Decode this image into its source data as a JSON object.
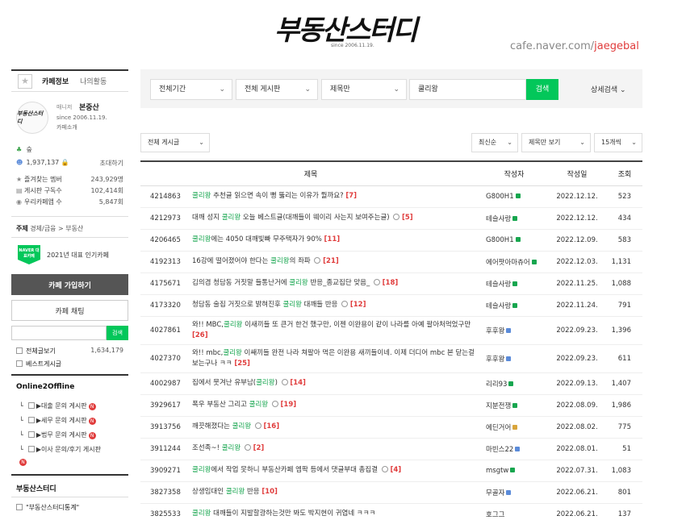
{
  "header": {
    "logo": "부동산스터디",
    "since": "since 2006.11.19.",
    "cafe_url_prefix": "cafe.naver.com/",
    "cafe_url_id": "jaegebal"
  },
  "sidebar": {
    "tabs": [
      "카페정보",
      "나의활동"
    ],
    "manager": {
      "avatar_text": "부동산스터디",
      "role": "매니저",
      "name": "본중산",
      "since": "since 2006.11.19.",
      "intro": "카페소개"
    },
    "stats": {
      "level": "숲",
      "members": "1,937,137",
      "invite": "초대하기",
      "fav_label": "즐겨찾는 멤버",
      "fav_value": "243,929명",
      "sub_label": "게시판 구독수",
      "sub_value": "102,414회",
      "app_label": "우리카페앱 수",
      "app_value": "5,847회"
    },
    "topic_label": "주제",
    "topic_value": "경제/금융 > 부동산",
    "badge_text": "NAVER 대표카페",
    "popular": "2021년 대표 인기카페",
    "join": "카페 가입하기",
    "chat": "카페 채팅",
    "search_btn": "검색",
    "all_posts_label": "전체글보기",
    "all_posts_count": "1,634,179",
    "best_posts": "베스트게시글",
    "section1": "Online2Offline",
    "boards": [
      "▶대출 문의 게시판",
      "▶세무 문의 게시판",
      "▶법무 문의 게시판",
      "▶이사 문의/후기 게시판"
    ],
    "new_badge": "N",
    "section2": "부동산스터디",
    "board_bottom": "\"부동산스터디통계\""
  },
  "search": {
    "period": "전체기간",
    "board": "전체 게시판",
    "scope": "제목만",
    "keyword": "쿨리왕",
    "button": "검색",
    "advanced": "상세검색"
  },
  "filters": {
    "board": "전체 게시글",
    "sort": "최신순",
    "view": "제목만 보기",
    "count": "15개씩"
  },
  "table": {
    "headers": [
      "제목",
      "작성자",
      "작성일",
      "조회"
    ],
    "rows": [
      {
        "num": "4214863",
        "pre": "",
        "hl": "쿨리왕",
        "post": " 추천글 읽으면 속이 뻥 뚫리는 이유가 뭘까요?",
        "cmt": "[7]",
        "emo": false,
        "author": "G800H1",
        "badge": "g",
        "date": "2022.12.12.",
        "views": "523"
      },
      {
        "num": "4212973",
        "pre": "대깨 성지 ",
        "hl": "쿨리왕",
        "post": " 오늘 베스트글(대깨들이 웨이리 사는지 보여주는글)",
        "cmt": "[5]",
        "emo": true,
        "author": "테슬사랑",
        "badge": "g",
        "date": "2022.12.12.",
        "views": "434"
      },
      {
        "num": "4206465",
        "pre": "",
        "hl": "쿨리왕",
        "post": "에는 4050 대깨빛빠 무주택자가 90%",
        "cmt": "[11]",
        "emo": false,
        "author": "G800H1",
        "badge": "g",
        "date": "2022.12.09.",
        "views": "583"
      },
      {
        "num": "4192313",
        "pre": "16강에 떨어졌어야 한다는 ",
        "hl": "쿨리왕",
        "post": "의 좌파",
        "cmt": "[21]",
        "emo": true,
        "author": "에어팟아마츄어",
        "badge": "g",
        "date": "2022.12.03.",
        "views": "1,131"
      },
      {
        "num": "4175671",
        "pre": "김의겸 청담동 거짓말 들통난거에 ",
        "hl": "쿨리왕",
        "post": " 반응_종교집단 맞음_",
        "cmt": "[18]",
        "emo": true,
        "author": "테슬사랑",
        "badge": "g",
        "date": "2022.11.25.",
        "views": "1,088"
      },
      {
        "num": "4173320",
        "pre": "청담동 술집 거짓으로 밝혀진후 ",
        "hl": "쿨리왕",
        "post": " 대깨들 반응",
        "cmt": "[12]",
        "emo": true,
        "author": "테슬사랑",
        "badge": "g",
        "date": "2022.11.24.",
        "views": "791"
      },
      {
        "num": "4027861",
        "pre": "와!! MBC,",
        "hl": "쿨리왕",
        "post": " 이새끼들 또 큰거 한건 했구만, 이젠 이완용이 같이 나라를 아예 팔아처먹었구만",
        "cmt": "[26]",
        "emo": false,
        "author": "후후왕",
        "badge": "b",
        "date": "2022.09.23.",
        "views": "1,396",
        "tall": true
      },
      {
        "num": "4027370",
        "pre": "와!! mbc,",
        "hl": "쿨리왕",
        "post": " 이쌔끼들 완전 나라 쳐팔아 먹은 이완용 새끼들이네. 이제 더디어 mbc 본 닫는걸 보는구나 ㅋㅋ",
        "cmt": "[25]",
        "emo": false,
        "author": "후후왕",
        "badge": "b",
        "date": "2022.09.23.",
        "views": "611",
        "tall": true
      },
      {
        "num": "4002987",
        "pre": "집에서 뭇겨난 유부남(",
        "hl": "쿨리왕",
        "post": ")",
        "cmt": "[14]",
        "emo": true,
        "author": "리리93",
        "badge": "g",
        "date": "2022.09.13.",
        "views": "1,407"
      },
      {
        "num": "3929617",
        "pre": "폭우 부동산 그리고 ",
        "hl": "쿨리왕",
        "post": "",
        "cmt": "[19]",
        "emo": true,
        "author": "지분전쟁",
        "badge": "g",
        "date": "2022.08.09.",
        "views": "1,986"
      },
      {
        "num": "3913756",
        "pre": "깨끗해졌다는 ",
        "hl": "쿨리왕",
        "post": "",
        "cmt": "[16]",
        "emo": true,
        "author": "에딘거어",
        "badge": "y",
        "date": "2022.08.02.",
        "views": "775"
      },
      {
        "num": "3911244",
        "pre": "조선족~! ",
        "hl": "쿨리왕",
        "post": "",
        "cmt": "[2]",
        "emo": true,
        "author": "마빈스22",
        "badge": "b",
        "date": "2022.08.01.",
        "views": "51"
      },
      {
        "num": "3909271",
        "pre": "",
        "hl": "쿨리왕",
        "post": "에서 작업 못하니 부동산카페 엠팍 등에서 댓글부대 총집결",
        "cmt": "[4]",
        "emo": true,
        "author": "msgtw",
        "badge": "g",
        "date": "2022.07.31.",
        "views": "1,083"
      },
      {
        "num": "3827358",
        "pre": "상생임대인 ",
        "hl": "쿨리왕",
        "post": " 반응",
        "cmt": "[10]",
        "emo": false,
        "author": "무골자",
        "badge": "b",
        "date": "2022.06.21.",
        "views": "801"
      },
      {
        "num": "3825533",
        "pre": "",
        "hl": "쿨리왕",
        "post": " 대깨들이 지발할광하는것만 봐도 박지현이 귀엽네 ㅋㅋㅋ",
        "cmt": "",
        "emo": false,
        "author": "호그그",
        "badge": "",
        "date": "2022.06.21.",
        "views": "137"
      }
    ]
  }
}
